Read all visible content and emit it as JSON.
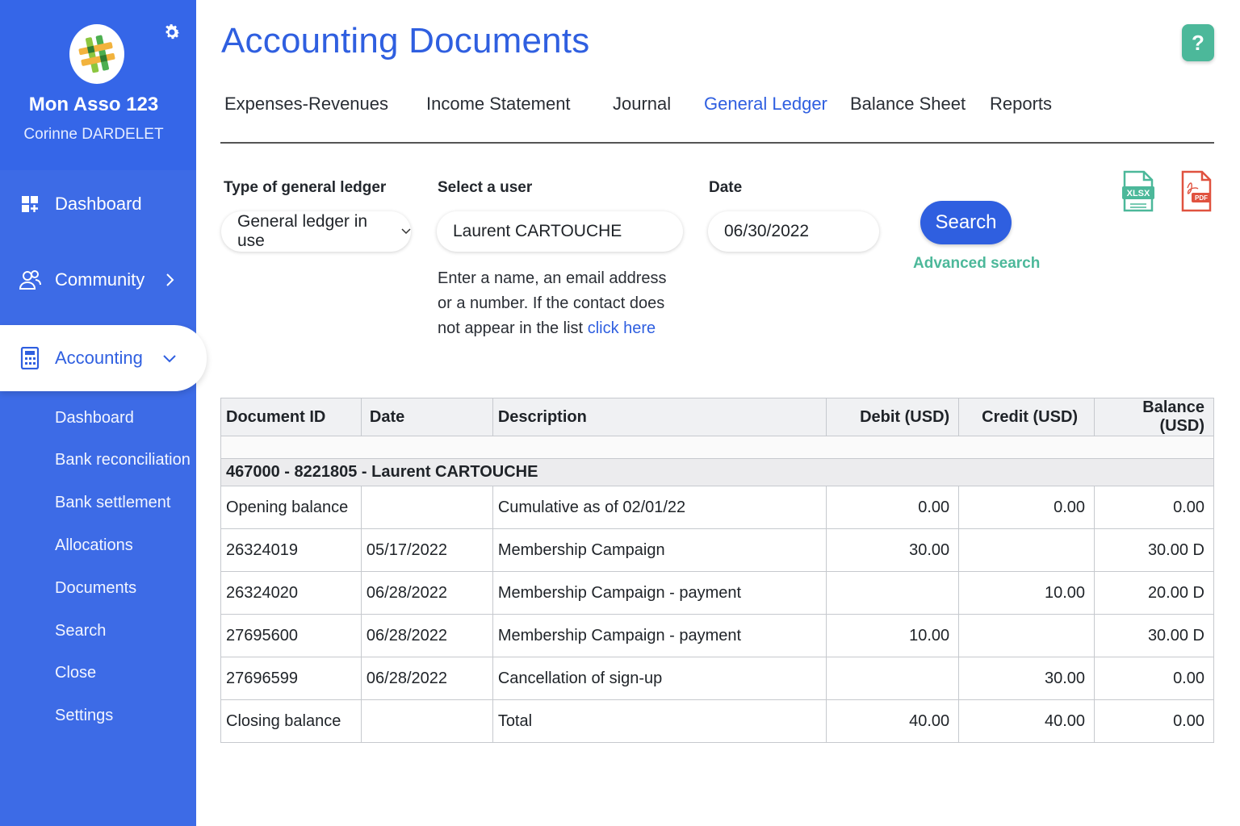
{
  "sidebar": {
    "org_name": "Mon Asso 123",
    "user_name": "Corinne DARDELET",
    "settings_icon": "gear-icon",
    "nav": {
      "dashboard": "Dashboard",
      "community": "Community",
      "accounting": "Accounting"
    },
    "sub_items": [
      "Dashboard",
      "Bank reconciliation",
      "Bank settlement",
      "Allocations",
      "Documents",
      "Search",
      "Close",
      "Settings"
    ],
    "colors": {
      "background": "#3d6be6",
      "active_text": "#2f5fe0"
    }
  },
  "header": {
    "title": "Accounting Documents",
    "help": "?"
  },
  "tabs": {
    "expenses_revenues": "Expenses-Revenues",
    "income_statement": "Income Statement",
    "journal": "Journal",
    "general_ledger": "General Ledger",
    "balance_sheet": "Balance Sheet",
    "reports": "Reports",
    "active": "General Ledger"
  },
  "filters": {
    "type_label": "Type of general ledger",
    "type_value": "General ledger in use",
    "user_label": "Select a user",
    "user_value": "Laurent CARTOUCHE",
    "date_label": "Date",
    "date_value": "06/30/2022",
    "hint_text": "Enter a name, an email address or a number. If the contact does not appear in the list ",
    "hint_link": "click here",
    "search_button": "Search",
    "advanced_search": "Advanced search"
  },
  "exports": {
    "xlsx": "XLSX",
    "pdf": "PDF",
    "colors": {
      "xlsx": "#4cb89a",
      "pdf": "#e0523f"
    }
  },
  "table": {
    "headers": {
      "doc_id": "Document ID",
      "date": "Date",
      "description": "Description",
      "debit": "Debit (USD)",
      "credit": "Credit (USD)",
      "balance": "Balance (USD)"
    },
    "group": "467000 - 8221805 - Laurent CARTOUCHE",
    "rows": [
      {
        "doc_id": "Opening balance",
        "date": "",
        "description": "Cumulative as of 02/01/22",
        "debit": "0.00",
        "credit": "0.00",
        "balance": "0.00"
      },
      {
        "doc_id": "26324019",
        "date": "05/17/2022",
        "description": "Membership Campaign",
        "debit": "30.00",
        "credit": "",
        "balance": "30.00 D"
      },
      {
        "doc_id": "26324020",
        "date": "06/28/2022",
        "description": "Membership Campaign - payment",
        "debit": "",
        "credit": "10.00",
        "balance": "20.00 D"
      },
      {
        "doc_id": "27695600",
        "date": "06/28/2022",
        "description": "Membership Campaign - payment",
        "debit": "10.00",
        "credit": "",
        "balance": "30.00 D"
      },
      {
        "doc_id": "27696599",
        "date": "06/28/2022",
        "description": "Cancellation of sign-up",
        "debit": "",
        "credit": "30.00",
        "balance": "0.00"
      },
      {
        "doc_id": "Closing balance",
        "date": "",
        "description": "Total",
        "debit": "40.00",
        "credit": "40.00",
        "balance": "0.00"
      }
    ]
  }
}
